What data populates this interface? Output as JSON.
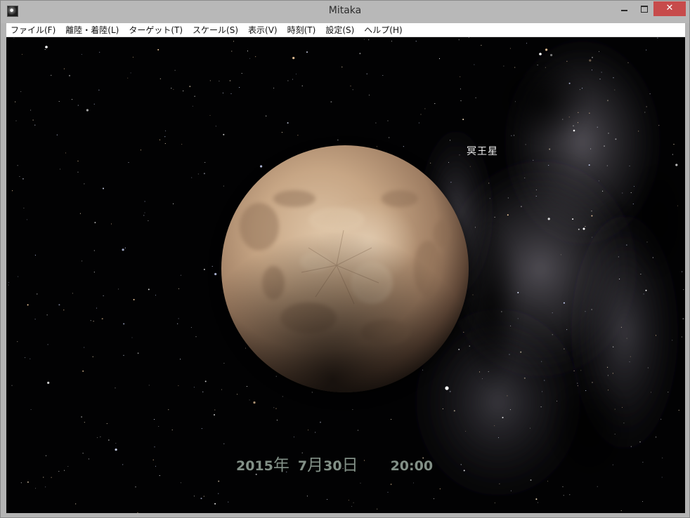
{
  "window": {
    "title": "Mitaka",
    "min_icon": "minimize-icon",
    "max_icon": "maximize-icon",
    "close_label": "✕"
  },
  "menu": {
    "items": [
      "ファイル(F)",
      "離陸・着陸(L)",
      "ターゲット(T)",
      "スケール(S)",
      "表示(V)",
      "時刻(T)",
      "設定(S)",
      "ヘルプ(H)"
    ]
  },
  "scene": {
    "target_label": "冥王星",
    "date": {
      "year": "2015",
      "year_unit": "年",
      "month": "7",
      "month_unit": "月",
      "day": "30",
      "day_unit": "日",
      "time": "20:00"
    }
  },
  "colors": {
    "titlebar": "#b8b8b8",
    "close_button": "#c74b4b",
    "space_background": "#020203",
    "date_text": "#a7b9ac",
    "planet_base": "#b8967a"
  }
}
